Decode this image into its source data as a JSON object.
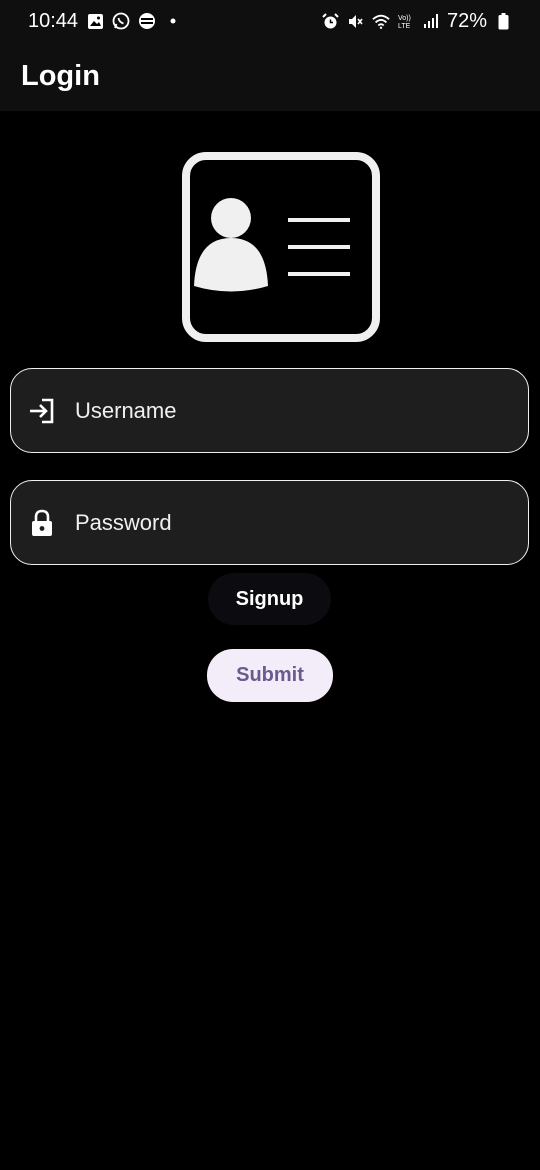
{
  "status_bar": {
    "time": "10:44",
    "battery": "72%",
    "notification_icons": [
      "gallery-icon",
      "whatsapp-icon",
      "vpn-icon",
      "dot-icon"
    ],
    "system_icons": [
      "alarm-icon",
      "mute-icon",
      "wifi-icon",
      "volte-icon",
      "signal-icon",
      "battery-icon"
    ]
  },
  "app_bar": {
    "title": "Login"
  },
  "hero": {
    "icon": "id-card-icon"
  },
  "form": {
    "username": {
      "placeholder": "Username",
      "value": "",
      "icon": "login-icon"
    },
    "password": {
      "placeholder": "Password",
      "value": "",
      "icon": "lock-icon"
    }
  },
  "buttons": {
    "signup_label": "Signup",
    "submit_label": "Submit"
  },
  "colors": {
    "background": "#000000",
    "app_bar": "#0f0f0f",
    "field_bg": "#1e1e1e",
    "field_border": "#f0f0f0",
    "submit_bg": "#f3edf9",
    "submit_text": "#6a5a8e"
  }
}
